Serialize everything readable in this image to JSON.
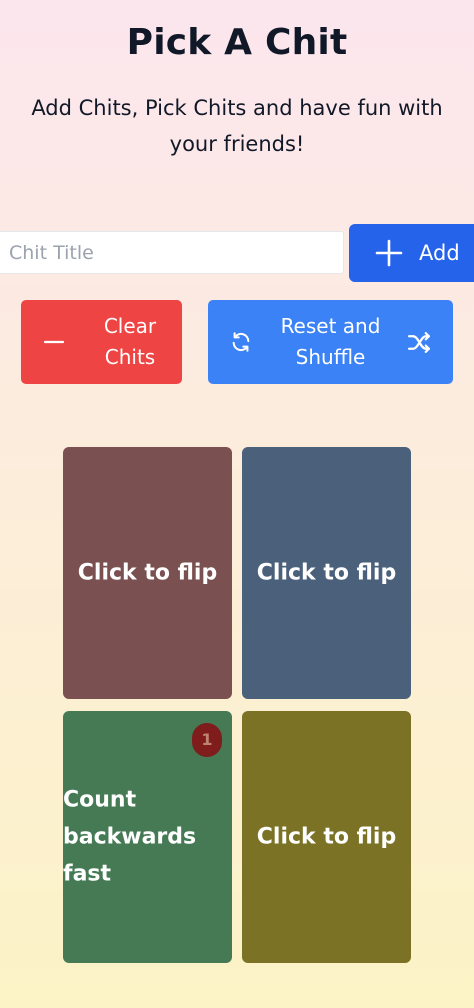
{
  "header": {
    "title": "Pick A Chit",
    "subtitle": "Add Chits, Pick Chits and have fun with your friends!"
  },
  "form": {
    "input_placeholder": "Chit Title",
    "input_value": "",
    "add_label": "Add",
    "add_icon": "plus-icon"
  },
  "actions": {
    "clear_label": "Clear Chits",
    "clear_icon": "minus-icon",
    "reset_label": "Reset and Shuffle",
    "reset_icon": "refresh-icon",
    "shuffle_icon": "shuffle-icon"
  },
  "cards": [
    {
      "state": "hidden",
      "label": "Click to flip",
      "color": "#7b5050"
    },
    {
      "state": "hidden",
      "label": "Click to flip",
      "color": "#4a607b"
    },
    {
      "state": "flipped",
      "label": "Count backwards fast",
      "badge": "1",
      "color": "#457a55",
      "badge_color": "#7f1d1d"
    },
    {
      "state": "hidden",
      "label": "Click to flip",
      "color": "#7b7225"
    }
  ],
  "colors": {
    "primary": "#2563eb",
    "reset": "#3b82f6",
    "danger": "#ef4444"
  }
}
